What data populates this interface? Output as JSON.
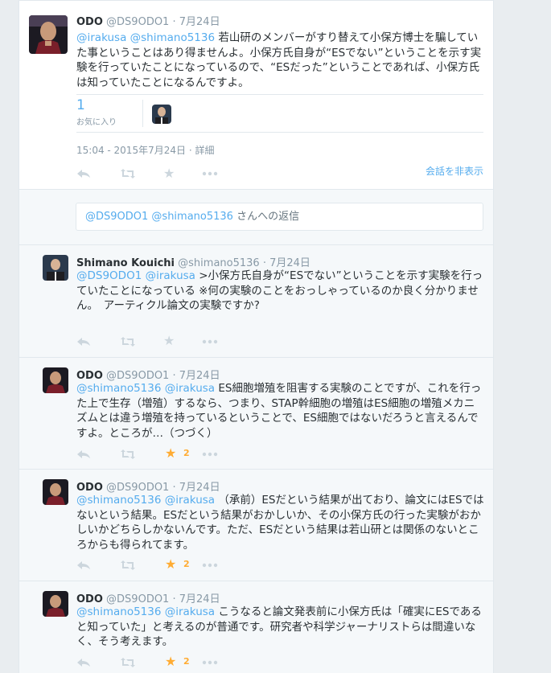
{
  "main_tweet": {
    "name": "ODO",
    "handle": "@DS9ODO1",
    "date": "7月24日",
    "mention1": "@irakusa",
    "mention2": "@shimano5136",
    "text": "若山研のメンバーがすり替えて小保方博士を騙していた事ということはあり得ませんよ。小保方氏自身が“ESでない”ということを示す実験を行っていたことになっているので、“ESだった”ということであれば、小保方氏は知っていたことになるんですよ。",
    "fav_count": "1",
    "fav_label": "お気に入り",
    "timestamp": "15:04 - 2015年7月24日",
    "details": "詳細",
    "hide_conversation": "会話を非表示"
  },
  "reply_box": {
    "mention1": "@DS9ODO1",
    "mention2": "@shimano5136",
    "suffix": "さんへの返信"
  },
  "replies": [
    {
      "name": "Shimano Kouichi",
      "handle": "@shimano5136",
      "date": "7月24日",
      "mention1": "@DS9ODO1",
      "mention2": "@irakusa",
      "text": ">小保方氏自身が“ESでない”ということを示す実験を行っていたことになっている ※何の実験のことをおっしゃっているのか良く分かりません。　アーティクル論文の実験ですか?",
      "fav_count": ""
    },
    {
      "name": "ODO",
      "handle": "@DS9ODO1",
      "date": "7月24日",
      "mention1": "@shimano5136",
      "mention2": "@irakusa",
      "text": "ES細胞増殖を阻害する実験のことですが、これを行った上で生存（増殖）するなら、つまり、STAP幹細胞の増殖はES細胞の増殖メカニズムとは違う増殖を持っているということで、ES細胞ではないだろうと言えるんですよ。ところが…（つづく）",
      "fav_count": "2"
    },
    {
      "name": "ODO",
      "handle": "@DS9ODO1",
      "date": "7月24日",
      "mention1": "@shimano5136",
      "mention2": "@irakusa",
      "text": "（承前）ESだという結果が出ており、論文にはESではないという結果。ESだという結果がおかしいか、その小保方氏の行った実験がおかしいかどちらしかないんです。ただ、ESだという結果は若山研とは関係のないところからも得られてます。",
      "fav_count": "2"
    },
    {
      "name": "ODO",
      "handle": "@DS9ODO1",
      "date": "7月24日",
      "mention1": "@shimano5136",
      "mention2": "@irakusa",
      "text": "こうなると論文発表前に小保方氏は「確実にESであると知っていた」と考えるのが普通です。研究者や科学ジャーナリストらは間違いなく、そう考えます。",
      "fav_count": "2"
    }
  ],
  "icons": [
    "reply-icon",
    "retweet-icon",
    "star-icon",
    "more-icon"
  ],
  "colors": {
    "link": "#55acee",
    "star_active": "#ffac33",
    "icon_idle": "#ccd6dd"
  }
}
